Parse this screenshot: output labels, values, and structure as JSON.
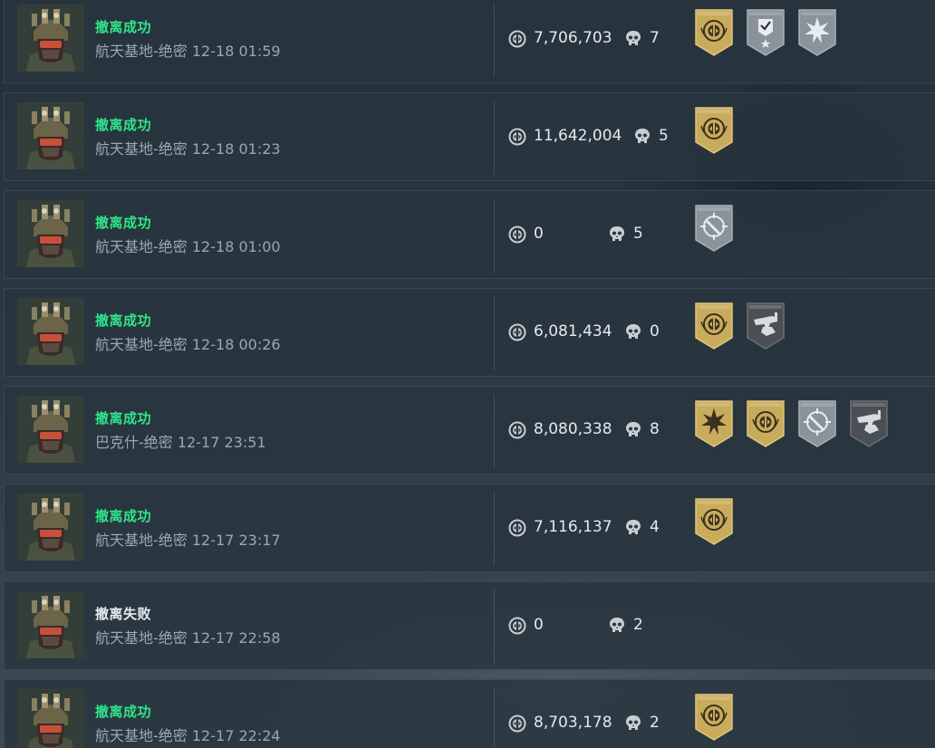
{
  "colors": {
    "success": "#2ee68a",
    "fail": "#e8ecef",
    "gold_badge": "#c9ab5c",
    "silver_badge": "#8a9399",
    "dark_badge": "#4a5055"
  },
  "matches": [
    {
      "status": "撤离成功",
      "outcome": "success",
      "map": "航天基地-绝密",
      "time": "12-18 01:59",
      "money": "7,706,703",
      "kills": "7",
      "badges": [
        {
          "icon": "gold-emblem-badge",
          "tier": "gold"
        },
        {
          "icon": "shield-check-star-badge",
          "tier": "silver"
        },
        {
          "icon": "starburst-badge",
          "tier": "silver"
        }
      ]
    },
    {
      "status": "撤离成功",
      "outcome": "success",
      "map": "航天基地-绝密",
      "time": "12-18 01:23",
      "money": "11,642,004",
      "kills": "5",
      "badges": [
        {
          "icon": "gold-emblem-badge",
          "tier": "gold"
        }
      ]
    },
    {
      "status": "撤离成功",
      "outcome": "success",
      "map": "航天基地-绝密",
      "time": "12-18 01:00",
      "money": "0",
      "kills": "5",
      "badges": [
        {
          "icon": "crosshair-knife-badge",
          "tier": "silver"
        }
      ]
    },
    {
      "status": "撤离成功",
      "outcome": "success",
      "map": "航天基地-绝密",
      "time": "12-18 00:26",
      "money": "6,081,434",
      "kills": "0",
      "badges": [
        {
          "icon": "gold-emblem-badge",
          "tier": "gold"
        },
        {
          "icon": "gun-hand-badge",
          "tier": "dark"
        }
      ]
    },
    {
      "status": "撤离成功",
      "outcome": "success",
      "map": "巴克什-绝密",
      "time": "12-17 23:51",
      "money": "8,080,338",
      "kills": "8",
      "badges": [
        {
          "icon": "gold-starburst-badge",
          "tier": "gold"
        },
        {
          "icon": "gold-emblem-badge",
          "tier": "gold"
        },
        {
          "icon": "crosshair-knife-badge",
          "tier": "silver"
        },
        {
          "icon": "gun-hand-badge",
          "tier": "dark"
        }
      ]
    },
    {
      "status": "撤离成功",
      "outcome": "success",
      "map": "航天基地-绝密",
      "time": "12-17 23:17",
      "money": "7,116,137",
      "kills": "4",
      "badges": [
        {
          "icon": "gold-emblem-badge",
          "tier": "gold"
        }
      ]
    },
    {
      "status": "撤离失败",
      "outcome": "fail",
      "map": "航天基地-绝密",
      "time": "12-17 22:58",
      "money": "0",
      "kills": "2",
      "badges": []
    },
    {
      "status": "撤离成功",
      "outcome": "success",
      "map": "航天基地-绝密",
      "time": "12-17 22:24",
      "money": "8,703,178",
      "kills": "2",
      "badges": [
        {
          "icon": "gold-emblem-badge",
          "tier": "gold"
        }
      ]
    }
  ]
}
